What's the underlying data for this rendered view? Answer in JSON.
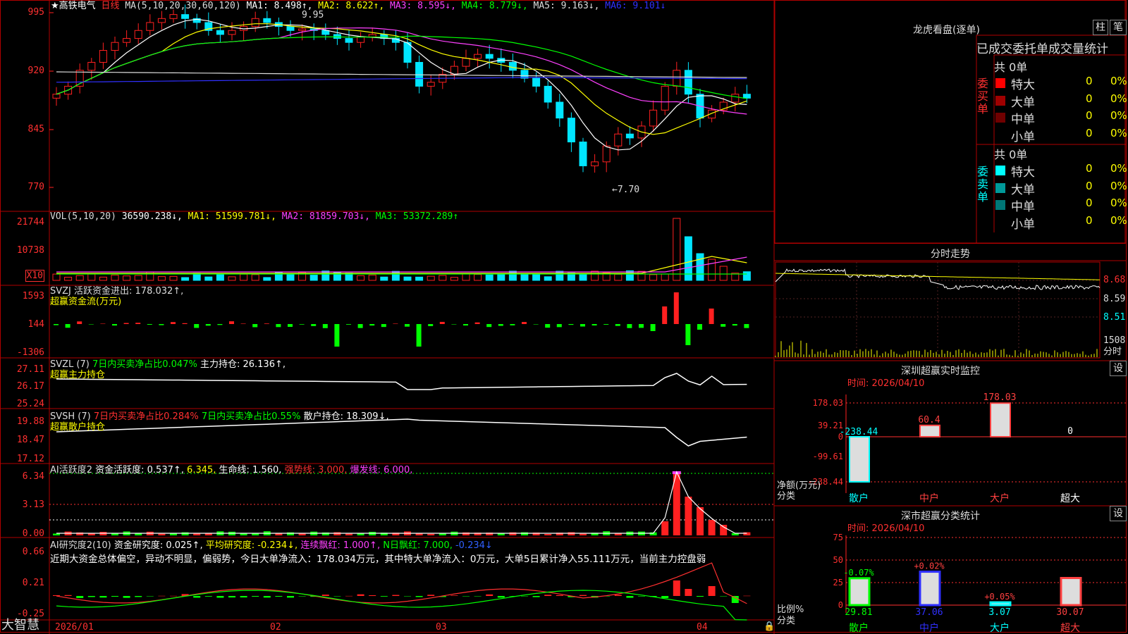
{
  "main": {
    "stock_name": "★高铁电气",
    "period": "日线",
    "ma_label": "MA(5,10,20,30,60,120)",
    "ma1": "MA1: 8.498↑,",
    "ma2": "MA2: 8.622↑,",
    "ma3": "MA3: 8.595↓,",
    "ma4": "MA4: 8.779↓,",
    "ma5": "MA5: 9.163↓,",
    "ma6": "MA6: 9.101↓",
    "high_mark": "9.95",
    "low_mark": "←7.70",
    "y_ticks": [
      "995",
      "920",
      "845",
      "770"
    ]
  },
  "volume": {
    "label": "VOL(5,10,20)",
    "value": "36590.238↓,",
    "ma1": "MA1: 51599.781↓,",
    "ma2": "MA2: 81859.703↓,",
    "ma3": "MA3: 53372.289↑",
    "y_ticks": [
      "21744",
      "10738"
    ],
    "unit": "X10"
  },
  "svzj": {
    "line1": "SVZJ  活跃资金进出: 178.032↑,",
    "line2": "超赢资金流(万元)",
    "y_ticks": [
      "1593",
      "144",
      "-1306"
    ]
  },
  "svzl": {
    "prefix": "SVZL (7)",
    "green": "7日内买卖净占比0.047%",
    "white": "主力持仓: 26.136↑,",
    "line2": "超赢主力持仓",
    "y_ticks": [
      "27.11",
      "26.17",
      "25.24"
    ]
  },
  "svsh": {
    "prefix": "SVSH (7)",
    "red": "7日内买卖净占比0.284%",
    "green": "7日内买卖净占比0.55%",
    "white": "散户持仓: 18.309↓,",
    "line2": "超赢散户持仓",
    "y_ticks": [
      "19.88",
      "18.47",
      "17.12"
    ]
  },
  "ai1": {
    "a": "AI活跃度2",
    "b": "资金活跃度: 0.537↑,",
    "c": "6.345,",
    "d": "生命线: 1.560,",
    "e": "强势线: 3.000,",
    "f": "爆发线: 6.000,",
    "y_ticks": [
      "6.34",
      "3.13",
      "0.00"
    ]
  },
  "ai2": {
    "a": "AI研究度2(10)",
    "b": "资金研究度: 0.025↑,",
    "c": "平均研究度: -0.234↓,",
    "d": "连续飘红: 1.000↑,",
    "e": "N日飘红: 7.000,",
    "f": "-0.234↓",
    "comment": "近期大资金总体偏空，异动不明显，偏弱势，今日大单净流入：178.034万元，其中特大单净流入：0万元，大单5日累计净入55.111万元，当前主力控盘弱",
    "y_ticks": [
      "0.66",
      "0.21",
      "-0.25"
    ]
  },
  "bottom": {
    "brand": "大智慧",
    "dates": [
      "2026/01",
      "02",
      "03",
      "04"
    ]
  },
  "right": {
    "title": "龙虎看盘(逐单)",
    "btn_zhu": "柱",
    "btn_bi": "笔",
    "stats_title": "已成交委托单成交量统计",
    "buy_label": "委买单",
    "sell_label": "委卖单",
    "buy_total": "共 0单",
    "sell_total": "共 0单",
    "buy_rows": [
      {
        "name": "特大",
        "count": "0",
        "pct": "0%",
        "color": "#ff0000"
      },
      {
        "name": "大单",
        "count": "0",
        "pct": "0%",
        "color": "#a00000"
      },
      {
        "name": "中单",
        "count": "0",
        "pct": "0%",
        "color": "#700000"
      },
      {
        "name": "小单",
        "count": "0",
        "pct": "0%",
        "color": "#000000"
      }
    ],
    "sell_rows": [
      {
        "name": "特大",
        "count": "0",
        "pct": "0%",
        "color": "#00ffff"
      },
      {
        "name": "大单",
        "count": "0",
        "pct": "0%",
        "color": "#009999"
      },
      {
        "name": "中单",
        "count": "0",
        "pct": "0%",
        "color": "#007777"
      },
      {
        "name": "小单",
        "count": "0",
        "pct": "0%",
        "color": "#000000"
      }
    ],
    "intraday_title": "分时走势",
    "intraday_ticks": [
      "8.68",
      "8.59",
      "8.51",
      "1508"
    ],
    "intraday_unit": "分时",
    "sz_monitor_title": "深圳超赢实时监控",
    "sz_monitor_time": "时间: 2026/04/10",
    "sz_monitor_ticks": [
      "178.03",
      "39.21",
      "0",
      "-99.61",
      "-238.44"
    ],
    "sz_monitor_unit": "净额(万元)",
    "sz_monitor_cat": "分类",
    "sz_monitor_bars": [
      {
        "name": "散户",
        "value": "-238.44",
        "color": "#00ffff"
      },
      {
        "name": "中户",
        "value": "60.4",
        "color": "#ff4040"
      },
      {
        "name": "大户",
        "value": "178.03",
        "color": "#ff4040"
      },
      {
        "name": "超大",
        "value": "0",
        "color": "#ffffff"
      }
    ],
    "sz_stat_title": "深市超赢分类统计",
    "sz_stat_time": "时间: 2026/04/10",
    "sz_stat_ticks": [
      "75",
      "50",
      "25",
      "0"
    ],
    "sz_stat_unit": "比例%",
    "sz_stat_cat": "分类",
    "sz_stat_bars": [
      {
        "name": "散户",
        "value": "29.81",
        "delta": "-0.07%",
        "color": "#00ff00",
        "delta_color": "#00ff00"
      },
      {
        "name": "中户",
        "value": "37.06",
        "delta": "+0.02%",
        "color": "#3030ff",
        "delta_color": "#ff4040"
      },
      {
        "name": "大户",
        "value": "3.07",
        "delta": "+0.05%",
        "color": "#00ffff",
        "delta_color": "#ff4040"
      },
      {
        "name": "超大",
        "value": "30.07",
        "delta": "",
        "color": "#ff4040",
        "delta_color": "#ff4040"
      }
    ],
    "btn_set": "设"
  }
}
